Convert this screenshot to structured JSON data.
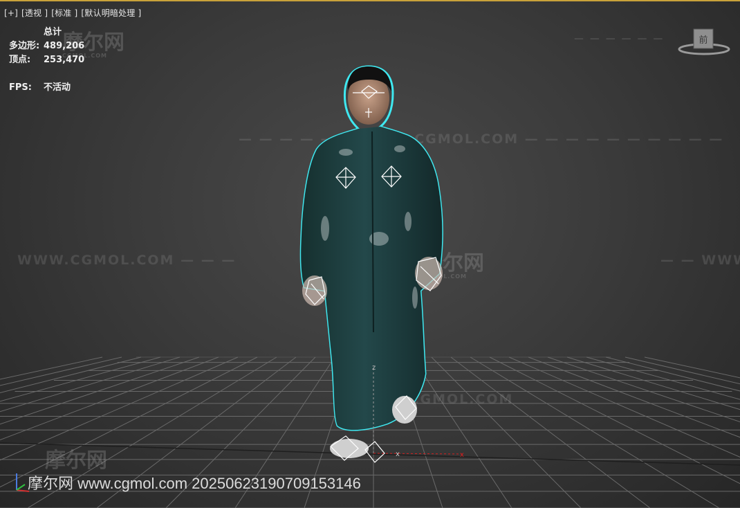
{
  "viewport": {
    "labels": [
      "[+]",
      "[透视 ]",
      "[标准 ]",
      "[默认明暗处理 ]"
    ]
  },
  "stats": {
    "header": "总计",
    "polys_label": "多边形:",
    "polys_value": "489,206",
    "verts_label": "顶点:",
    "verts_value": "253,470",
    "fps_label": "FPS:",
    "fps_value": "不活动"
  },
  "viewcube": {
    "face_label": "前"
  },
  "watermarks": {
    "url": "WWW.CGMOL.COM",
    "logo": "摩尔网",
    "logo_sub": "CGMOL.COM",
    "footer": "摩尔网 www.cgmol.com 20250623190709153146"
  },
  "colors": {
    "selection_outline": "#3fe8f0",
    "robe": "#1e3a3c",
    "grid": "#6a6a6a",
    "accent_border": "#c9a23a"
  }
}
